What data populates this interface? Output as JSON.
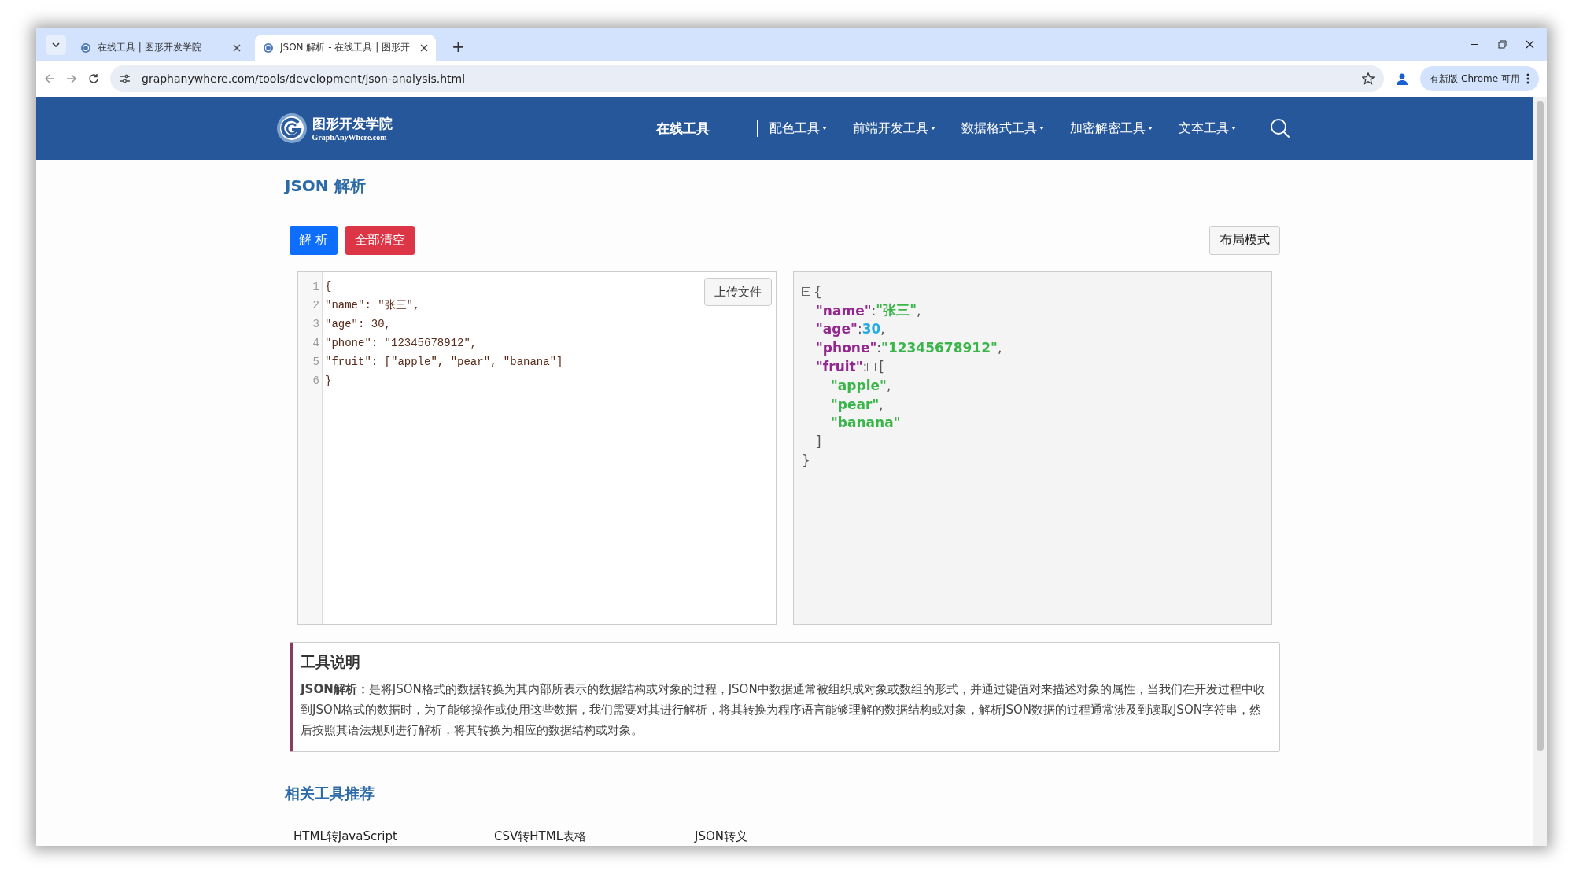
{
  "browser": {
    "tabs": [
      {
        "title": "在线工具 | 图形开发学院",
        "selected": false
      },
      {
        "title": "JSON 解析 - 在线工具 | 图形开",
        "selected": true
      }
    ],
    "new_tab": "+",
    "url": "graphanywhere.com/tools/development/json-analysis.html",
    "update_button": "有新版 Chrome 可用"
  },
  "site_nav": {
    "logo_title": "图形开发学院",
    "logo_subtitle": "GraphAnyWhere.com",
    "home": "在线工具",
    "menus": [
      "配色工具",
      "前端开发工具",
      "数据格式工具",
      "加密解密工具",
      "文本工具"
    ]
  },
  "page_title": "JSON 解析",
  "buttons": {
    "parse": "解 析",
    "clear": "全部清空",
    "layout": "布局模式",
    "upload": "上传文件"
  },
  "editor": {
    "lines": [
      {
        "number": "1",
        "text": "{"
      },
      {
        "number": "2",
        "text": "\"name\": \"张三\","
      },
      {
        "number": "3",
        "text": "\"age\": 30,"
      },
      {
        "number": "4",
        "text": "\"phone\": \"12345678912\","
      },
      {
        "number": "5",
        "text": "\"fruit\": [\"apple\", \"pear\", \"banana\"]"
      },
      {
        "number": "6",
        "text": "}"
      }
    ]
  },
  "tree": {
    "open": "{",
    "close": "}",
    "expanded": true,
    "members": [
      {
        "key": "\"name\"",
        "sep": ":",
        "kind": "string",
        "value": "\"张三\"",
        "trail": ","
      },
      {
        "key": "\"age\"",
        "sep": ":",
        "kind": "number",
        "value": "30",
        "trail": ","
      },
      {
        "key": "\"phone\"",
        "sep": ":",
        "kind": "string",
        "value": "\"12345678912\"",
        "trail": ","
      },
      {
        "key": "\"fruit\"",
        "sep": ":",
        "kind": "array",
        "open": "[",
        "close": "]",
        "expanded": true,
        "children": [
          {
            "kind": "string",
            "value": "\"apple\"",
            "trail": ","
          },
          {
            "kind": "string",
            "value": "\"pear\"",
            "trail": ","
          },
          {
            "kind": "string",
            "value": "\"banana\""
          }
        ]
      }
    ]
  },
  "description": {
    "heading": "工具说明",
    "text": "**JSON解析：**是将JSON格式的数据转换为其内部所表示的数据结构或对象的过程，JSON中数据通常被组织成对象或数组的形式，并通过键值对来描述对象的属性，当我们在开发过程中收到JSON格式的数据时，为了能够操作或使用这些数据，我们需要对其进行解析，将其转换为程序语言能够理解的数据结构或对象，解析JSON数据的过程通常涉及到读取JSON字符串，然后按照其语法规则进行解析，将其转换为相应的数据结构或对象。"
  },
  "related": {
    "heading": "相关工具推荐",
    "links": [
      "HTML转JavaScript",
      "CSV转HTML表格",
      "JSON转义"
    ]
  }
}
